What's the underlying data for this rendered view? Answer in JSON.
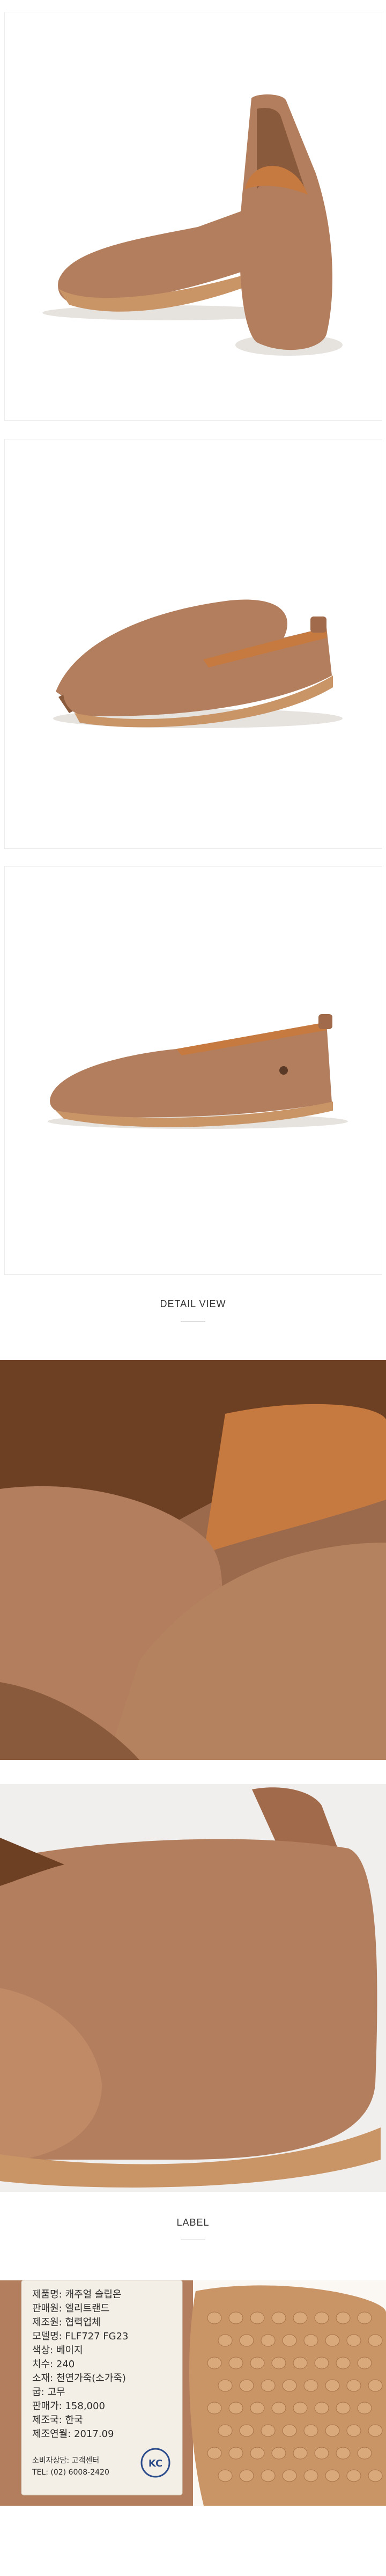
{
  "sections": {
    "detail_view_title": "DETAIL VIEW",
    "label_title": "LABEL"
  },
  "product_label": {
    "lines": [
      "제품명: 캐주얼 슬립온",
      "판매원: 엘리트랜드",
      "제조원: 협력업체",
      "모델명: FLF727 FG23",
      "색상: 베이지",
      "치수: 240",
      "소재: 천연가죽(소가죽)",
      "굽: 고무",
      "판매가: 158,000",
      "제조국: 한국",
      "제조연월: 2017.09"
    ],
    "footer_lines": [
      "소비자상담: 고객센터",
      "TEL: (02) 6008-2420"
    ],
    "kc_mark": "KC"
  },
  "colors": {
    "leather": "#b27e5e",
    "leather_shadow": "#8a5a3c",
    "lining": "#c77a3f",
    "sole": "#c99466",
    "title_rule": "#c9c9c9"
  }
}
